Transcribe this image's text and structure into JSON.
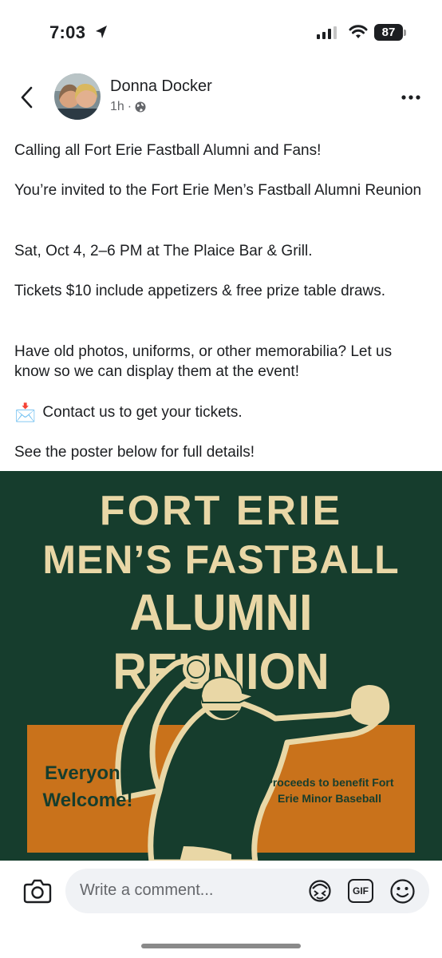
{
  "status_bar": {
    "time": "7:03",
    "battery": "87"
  },
  "header": {
    "author": "Donna Docker",
    "time_ago": "1h",
    "separator": "·",
    "icons": {
      "back": "chevron-left-icon",
      "privacy": "globe-icon",
      "more": "more-horizontal-icon"
    }
  },
  "post": {
    "line1": "Calling all Fort Erie Fastball Alumni and Fans!",
    "line2": "You’re invited to the Fort Erie Men’s Fastball Alumni Reunion",
    "line3": "Sat, Oct 4, 2–6 PM at The Plaice Bar & Grill.",
    "line4": "Tickets $10 include appetizers & free prize table draws.",
    "line5": "Have old photos, uniforms, or other memorabilia? Let us know so we can display them at the event!",
    "line6_emoji": "📩",
    "line6": "Contact us to get your tickets.",
    "line7": "See the poster below for full details!"
  },
  "poster": {
    "title1": "FORT ERIE",
    "title2": "MEN’S FASTBALL",
    "title3": "ALUMNI REUNION",
    "welcome": "Everyone Welcome!",
    "proceeds": "Proceeds to benefit Fort Erie Minor Baseball",
    "colors": {
      "background": "#163d2d",
      "title": "#e9d7a6",
      "box": "#c9721b"
    }
  },
  "comment_bar": {
    "placeholder": "Write a comment...",
    "gif_label": "GIF",
    "icons": {
      "camera": "camera-icon",
      "avatar": "avatar-sticker-icon",
      "gif": "gif-icon",
      "emoji": "emoji-icon"
    }
  }
}
